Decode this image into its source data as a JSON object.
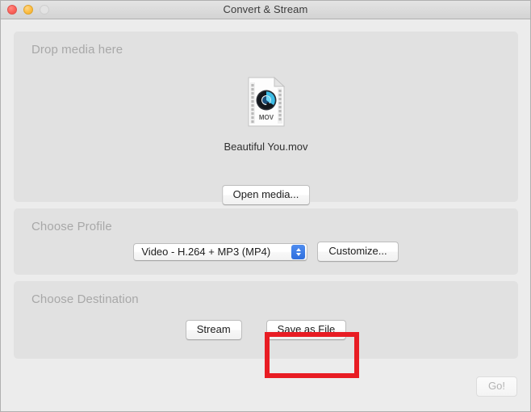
{
  "window": {
    "title": "Convert & Stream",
    "traffic_lights": [
      {
        "name": "close",
        "color": "#fb615a",
        "enabled": true
      },
      {
        "name": "minimize",
        "color": "#fcbd43",
        "enabled": true
      },
      {
        "name": "zoom",
        "color": "#e3e3e3",
        "enabled": false
      }
    ]
  },
  "media_panel": {
    "label": "Drop media here",
    "file": {
      "name": "Beautiful You.mov",
      "icon": "quicktime-mov-file-icon",
      "icon_badge": "MOV"
    },
    "open_media_button": "Open media..."
  },
  "profile_panel": {
    "label": "Choose Profile",
    "selected_profile": "Video - H.264 + MP3 (MP4)",
    "customize_button": "Customize..."
  },
  "destination_panel": {
    "label": "Choose Destination",
    "stream_button": "Stream",
    "save_as_file_button": "Save as File"
  },
  "footer": {
    "go_button": "Go!",
    "go_enabled": false
  },
  "annotation": {
    "highlight_color": "#e81c23",
    "target": "save-as-file-button"
  }
}
